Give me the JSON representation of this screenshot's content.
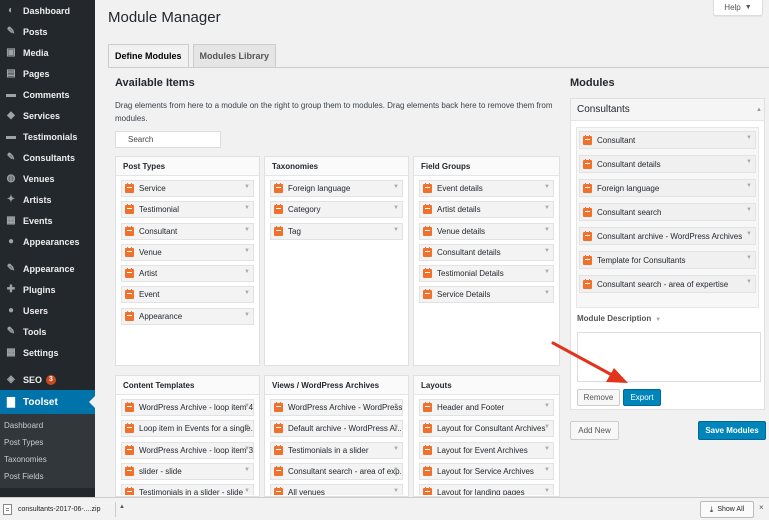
{
  "sidebar": {
    "items": [
      {
        "label": "Dashboard",
        "icon": "dashboard-icon",
        "glyph": "◐"
      },
      {
        "label": "Posts",
        "icon": "pin-icon",
        "glyph": "✎"
      },
      {
        "label": "Media",
        "icon": "media-icon",
        "glyph": "▣"
      },
      {
        "label": "Pages",
        "icon": "pages-icon",
        "glyph": "▤"
      },
      {
        "label": "Comments",
        "icon": "comments-icon",
        "glyph": "▬"
      },
      {
        "label": "Services",
        "icon": "car-icon",
        "glyph": "◆"
      },
      {
        "label": "Testimonials",
        "icon": "testimonials-icon",
        "glyph": "▬"
      },
      {
        "label": "Consultants",
        "icon": "tools-icon",
        "glyph": "✎"
      },
      {
        "label": "Venues",
        "icon": "globe-icon",
        "glyph": "◍"
      },
      {
        "label": "Artists",
        "icon": "palette-icon",
        "glyph": "✦"
      },
      {
        "label": "Events",
        "icon": "calendar-icon",
        "glyph": "▦"
      },
      {
        "label": "Appearances",
        "icon": "group-icon",
        "glyph": "●"
      }
    ],
    "items2": [
      {
        "label": "Appearance",
        "icon": "brush-icon",
        "glyph": "✎"
      },
      {
        "label": "Plugins",
        "icon": "plugin-icon",
        "glyph": "✚"
      },
      {
        "label": "Users",
        "icon": "user-icon",
        "glyph": "●"
      },
      {
        "label": "Tools",
        "icon": "wrench-icon",
        "glyph": "✎"
      },
      {
        "label": "Settings",
        "icon": "settings-icon",
        "glyph": "▦"
      }
    ],
    "seo": {
      "label": "SEO",
      "badge": "3",
      "glyph": "◈"
    },
    "toolset": {
      "label": "Toolset",
      "glyph": "▇"
    },
    "submenu": [
      "Dashboard",
      "Post Types",
      "Taxonomies",
      "Post Fields"
    ]
  },
  "header": {
    "title": "Module Manager",
    "help": "Help"
  },
  "tabs": [
    {
      "label": "Define Modules",
      "active": true
    },
    {
      "label": "Modules Library",
      "active": false
    }
  ],
  "available": {
    "title": "Available Items",
    "description": "Drag elements from here to a module on the right to group them to modules. Drag elements back here to remove them from modules.",
    "search_placeholder": "Search",
    "panels": [
      {
        "key": "post_types",
        "title": "Post Types",
        "items": [
          "Service",
          "Testimonial",
          "Consultant",
          "Venue",
          "Artist",
          "Event",
          "Appearance"
        ]
      },
      {
        "key": "taxonomies",
        "title": "Taxonomies",
        "items": [
          "Foreign language",
          "Category",
          "Tag"
        ]
      },
      {
        "key": "field_groups",
        "title": "Field Groups",
        "items": [
          "Event details",
          "Artist details",
          "Venue details",
          "Consultant details",
          "Testimonial Details",
          "Service Details"
        ]
      },
      {
        "key": "content_templates",
        "title": "Content Templates",
        "items": [
          "WordPress Archive - loop item 4",
          "Loop item in Events for a single...",
          "WordPress Archive - loop item 3",
          "slider - slide",
          "Testimonials in a slider - slide"
        ]
      },
      {
        "key": "views",
        "title": "Views / WordPress Archives",
        "items": [
          "WordPress Archive - WordPress...",
          "Default archive - WordPress Ar...",
          "Testimonials in a slider",
          "Consultant search - area of exp...",
          "All venues"
        ]
      },
      {
        "key": "layouts",
        "title": "Layouts",
        "items": [
          "Header and Footer",
          "Layout for Consultant Archives",
          "Layout for Event Archives",
          "Layout for Service Archives",
          "Layout for landing pages"
        ]
      }
    ]
  },
  "modules": {
    "title": "Modules",
    "module_name": "Consultants",
    "items": [
      "Consultant",
      "Consultant details",
      "Foreign language",
      "Consultant search",
      "Consultant archive - WordPress Archives",
      "Template for Consultants",
      "Consultant search - area of expertise"
    ],
    "description_label": "Module Description",
    "remove_label": "Remove",
    "export_label": "Export",
    "add_new_label": "Add New",
    "save_label": "Save Modules"
  },
  "download_bar": {
    "file_name": "consultants-2017-06-....zip",
    "show_all": "Show All",
    "close": "×"
  },
  "colors": {
    "sidebar_bg": "#23282d",
    "accent": "#0073aa",
    "primary_button": "#0085ba",
    "item_icon": "#f0712c",
    "annotation_arrow": "#e2341d"
  }
}
